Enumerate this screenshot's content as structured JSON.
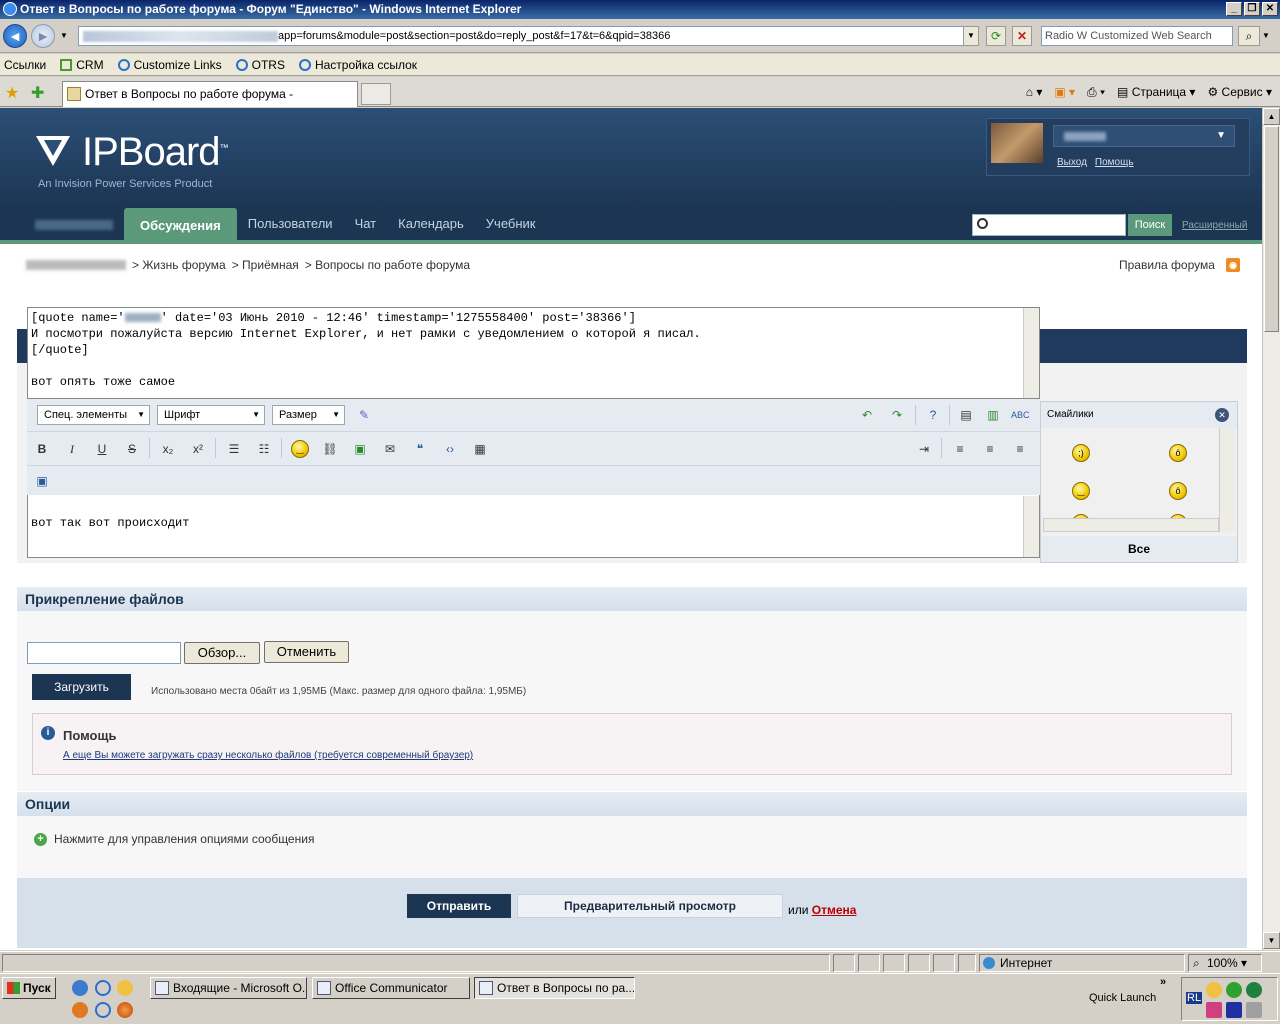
{
  "window": {
    "title": "Ответ в Вопросы по работе форума - Форум \"Единство\" - Windows Internet Explorer",
    "minimize": "_",
    "maximize": "❐",
    "close": "✕"
  },
  "address": {
    "url_tail": "app=forums&module=post&section=post&do=reply_post&f=17&t=6&qpid=38366",
    "search_placeholder": "Radio W Customized Web Search"
  },
  "links_bar": {
    "items": [
      "Ссылки",
      "CRM",
      "Customize Links",
      "OTRS",
      "Настройка ссылок"
    ]
  },
  "tabs": {
    "active_title": "Ответ в Вопросы по работе форума -"
  },
  "command_bar": {
    "page": "Страница",
    "tools": "Сервис"
  },
  "forum": {
    "logo_name": "IPBoard",
    "logo_tm": "™",
    "logo_tag": "An Invision Power Services Product",
    "user_links": {
      "logout": "Выход",
      "help": "Помощь"
    },
    "nav": [
      "Обсуждения",
      "Пользователи",
      "Чат",
      "Календарь",
      "Учебник"
    ],
    "search_button": "Поиск",
    "advanced_search": "Расширенный",
    "breadcrumb": [
      "> Жизнь форума",
      "> Приёмная",
      "> Вопросы по работе форума"
    ],
    "rules": "Правила форума"
  },
  "editor": {
    "quote_line1_a": "[quote name='",
    "quote_line1_b": "' date='03 Июнь 2010 - 12:46' timestamp='1275558400' post='38366']",
    "quote_line2": "И посмотри пожалуйста версию Internet Explorer, и нет рамки с уведомлением о которой я писал.",
    "quote_line3": "[/quote]",
    "quote_line5": "вот опять тоже самое",
    "selects": [
      "Спец. элементы",
      "Шрифт",
      "Размер"
    ],
    "body_text": "вот так вот происходит",
    "smileys_title": "Смайлики",
    "smileys_all": "Все"
  },
  "attachments": {
    "title": "Прикрепление файлов",
    "browse": "Обзор...",
    "cancel": "Отменить",
    "upload": "Загрузить",
    "quota": "Использовано места 0байт из 1,95МБ (Макс. размер для одного файла: 1,95МБ)",
    "help_title": "Помощь",
    "help_link": "А еще Вы можете загружать сразу несколько файлов (требуется современный браузер)"
  },
  "options": {
    "title": "Опции",
    "toggle": "Нажмите для управления опциями сообщения"
  },
  "submit": {
    "send": "Отправить",
    "preview": "Предварительный просмотр",
    "or": "или",
    "cancel": "Отмена"
  },
  "statusbar": {
    "zone": "Интернет",
    "zoom": "100%"
  },
  "taskbar": {
    "start": "Пуск",
    "tasks": [
      "Входящие - Microsoft O...",
      "Office Communicator",
      "Ответ в Вопросы по ра..."
    ],
    "quick_launch": "Quick Launch",
    "lang": "RL"
  }
}
